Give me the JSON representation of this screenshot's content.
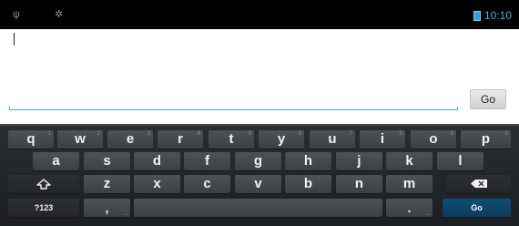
{
  "status_bar": {
    "time": "10:10",
    "usb_icon_glyph": "ψ",
    "debug_icon_glyph": "✲",
    "accent_color": "#33b5e5"
  },
  "form": {
    "input_value": "",
    "go_button_label": "Go"
  },
  "keyboard": {
    "row1": [
      {
        "label": "q",
        "hint": "1"
      },
      {
        "label": "w",
        "hint": "2"
      },
      {
        "label": "e",
        "hint": "3"
      },
      {
        "label": "r",
        "hint": "4"
      },
      {
        "label": "t",
        "hint": "5"
      },
      {
        "label": "y",
        "hint": "6"
      },
      {
        "label": "u",
        "hint": "7"
      },
      {
        "label": "i",
        "hint": "8"
      },
      {
        "label": "o",
        "hint": "9"
      },
      {
        "label": "p",
        "hint": "0"
      }
    ],
    "row2": [
      "a",
      "s",
      "d",
      "f",
      "g",
      "h",
      "j",
      "k",
      "l"
    ],
    "row3": [
      "z",
      "x",
      "c",
      "v",
      "b",
      "n",
      "m"
    ],
    "shift_icon": "shift-arrow",
    "delete_icon": "backspace",
    "symbols_label": "?123",
    "comma_label": ",",
    "comma_hint": "_",
    "period_label": ".",
    "period_hint": "_",
    "go_label": "Go"
  }
}
